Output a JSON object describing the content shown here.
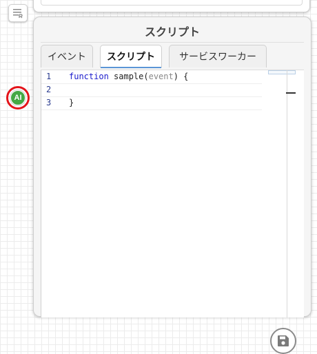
{
  "panel": {
    "title": "スクリプト"
  },
  "tabs": [
    {
      "label": "イベント",
      "active": false
    },
    {
      "label": "スクリプト",
      "active": true
    },
    {
      "label": "サービスワーカー",
      "active": false
    }
  ],
  "ai_badge": {
    "label": "AI"
  },
  "editor": {
    "lines": [
      {
        "number": "1",
        "keyword": "function",
        "name": " sample(",
        "param": "event",
        "rest": ") {"
      },
      {
        "number": "2",
        "text": ""
      },
      {
        "number": "3",
        "text": "}"
      }
    ]
  },
  "icons": {
    "document": "document-icon",
    "save": "save-icon"
  },
  "colors": {
    "ai_badge": "#44a844",
    "highlight_ring": "#e4131a",
    "active_tab_underline": "#5b95d6",
    "keyword": "#1a1acc",
    "line_number": "#2a3b8f"
  }
}
